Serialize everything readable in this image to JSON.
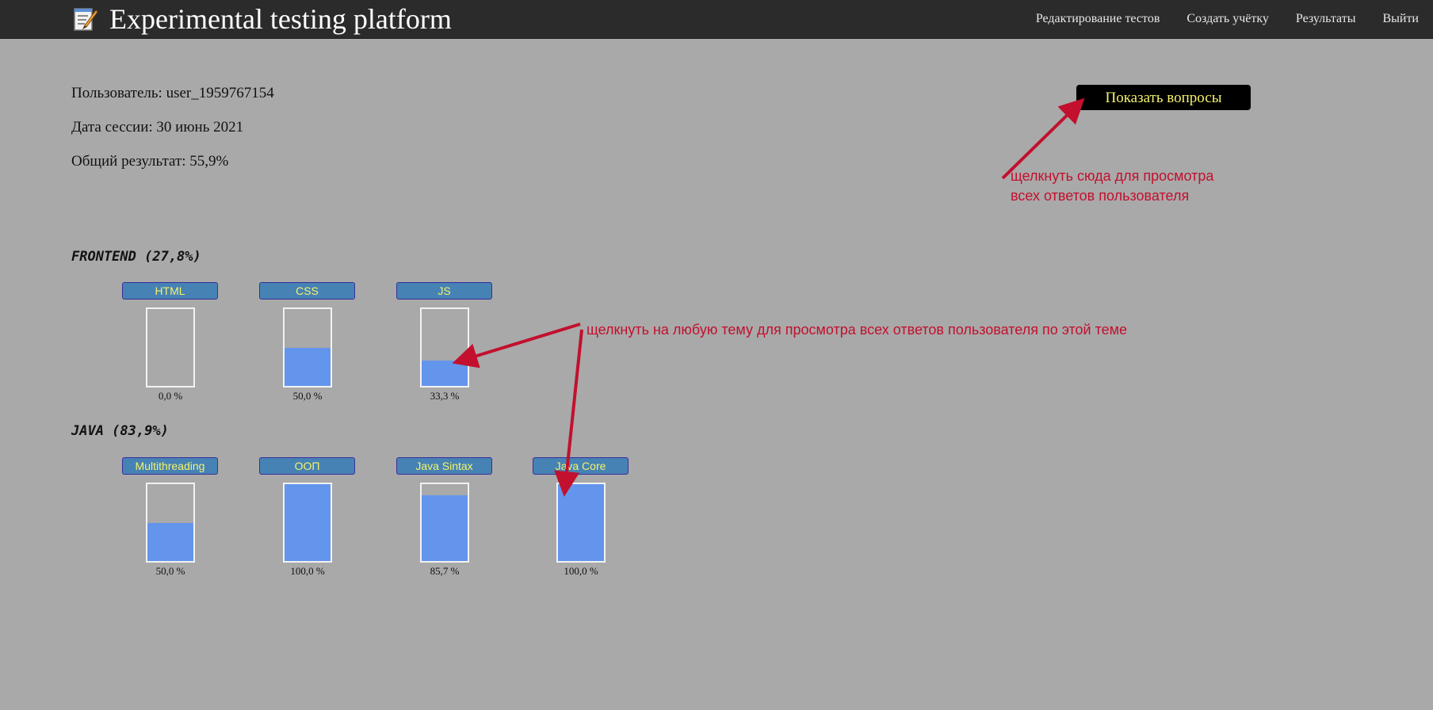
{
  "header": {
    "title": "Experimental testing platform",
    "nav": [
      {
        "label": "Редактирование тестов"
      },
      {
        "label": "Создать учётку"
      },
      {
        "label": "Результаты"
      },
      {
        "label": "Выйти"
      }
    ]
  },
  "session": {
    "user_line": "Пользователь: user_1959767154",
    "date_line": "Дата сессии: 30 июнь 2021",
    "result_line": "Общий результат: 55,9%"
  },
  "show_questions_label": "Показать вопросы",
  "annotations": {
    "show_hint_line1": "щелкнуть сюда для просмотра",
    "show_hint_line2": "всех ответов пользователя",
    "topic_hint": "щелкнуть на любую тему для просмотра всех ответов пользователя по этой теме",
    "color": "#c2102e"
  },
  "sections": [
    {
      "title": "FRONTEND (27,8%)",
      "topics": [
        {
          "name": "HTML",
          "value": 0.0,
          "label": "0,0 %"
        },
        {
          "name": "CSS",
          "value": 50.0,
          "label": "50,0 %"
        },
        {
          "name": "JS",
          "value": 33.3,
          "label": "33,3 %"
        }
      ]
    },
    {
      "title": "JAVA (83,9%)",
      "topics": [
        {
          "name": "Multithreading",
          "value": 50.0,
          "label": "50,0 %"
        },
        {
          "name": "ООП",
          "value": 100.0,
          "label": "100,0 %"
        },
        {
          "name": "Java Sintax",
          "value": 85.7,
          "label": "85,7 %"
        },
        {
          "name": "Java Core",
          "value": 100.0,
          "label": "100,0 %"
        }
      ]
    }
  ],
  "colors": {
    "background": "#a9a9a9",
    "navbar": "#2b2b2b",
    "topic_button": "#4682b4",
    "topic_text": "#f5f36a",
    "bar_fill": "#6495ed",
    "button_bg": "#000000",
    "button_text": "#f4f06a"
  }
}
